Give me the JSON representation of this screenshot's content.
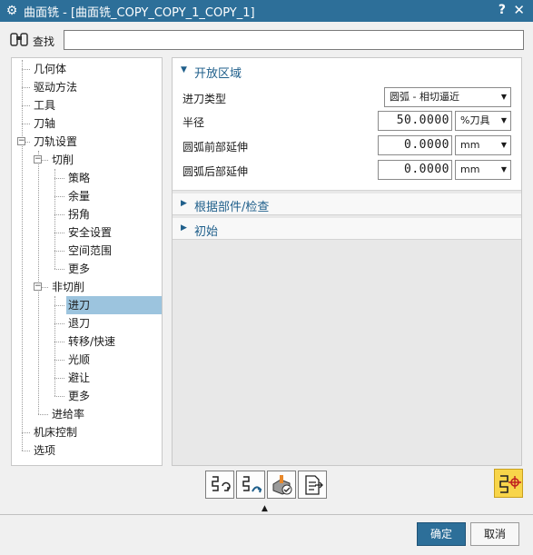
{
  "window": {
    "title": "曲面铣 - [曲面铣_COPY_COPY_1_COPY_1]",
    "help": "?",
    "close": "✕"
  },
  "search": {
    "label": "查找",
    "value": ""
  },
  "tree": [
    {
      "label": "几何体"
    },
    {
      "label": "驱动方法"
    },
    {
      "label": "工具"
    },
    {
      "label": "刀轴"
    },
    {
      "label": "刀轨设置",
      "toggle": "−"
    },
    {
      "label": "切削",
      "toggle": "−"
    },
    {
      "label": "策略"
    },
    {
      "label": "余量"
    },
    {
      "label": "拐角"
    },
    {
      "label": "安全设置"
    },
    {
      "label": "空间范围"
    },
    {
      "label": "更多"
    },
    {
      "label": "非切削",
      "toggle": "−"
    },
    {
      "label": "进刀",
      "selected": true
    },
    {
      "label": "退刀"
    },
    {
      "label": "转移/快速"
    },
    {
      "label": "光顺"
    },
    {
      "label": "避让"
    },
    {
      "label": "更多"
    },
    {
      "label": "进给率"
    },
    {
      "label": "机床控制"
    },
    {
      "label": "选项"
    }
  ],
  "open_area": {
    "header": "开放区域",
    "rows": [
      {
        "label": "进刀类型",
        "dropdown": "圆弧 - 相切逼近"
      },
      {
        "label": "半径",
        "value": "50.0000",
        "unit": "%刀具"
      },
      {
        "label": "圆弧前部延伸",
        "value": "0.0000",
        "unit": "mm"
      },
      {
        "label": "圆弧后部延伸",
        "value": "0.0000",
        "unit": "mm"
      }
    ]
  },
  "groups": {
    "part_check": "根据部件/检查",
    "initial": "初始"
  },
  "buttons": {
    "ok": "确定",
    "cancel": "取消"
  },
  "colors": {
    "titlebar": "#2d6f99",
    "accent_text": "#1f5f8b",
    "selection": "#9cc4de",
    "highlight_tool": "#f8d54a"
  }
}
